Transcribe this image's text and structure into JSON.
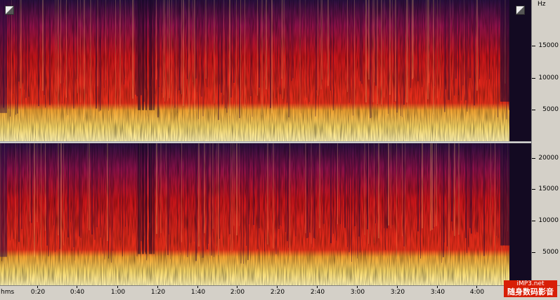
{
  "spectrogram": {
    "freq_unit": "Hz",
    "top_channel_freq_labels": [
      "15000",
      "10000",
      "5000"
    ],
    "bottom_channel_freq_labels": [
      "20000",
      "15000",
      "10000",
      "5000"
    ],
    "time_unit": "hms",
    "time_labels": [
      "0:20",
      "0:40",
      "1:00",
      "1:20",
      "1:40",
      "2:00",
      "2:20",
      "2:40",
      "3:00",
      "3:20",
      "3:40",
      "4:00"
    ],
    "colors": {
      "background": "#000000",
      "low": "#2a1040",
      "mid": "#c8141a",
      "high": "#f4d466",
      "peak": "#fff3b0",
      "ruler": "#d4d0c8"
    }
  },
  "corner_buttons": {
    "left_icon": "zoom-corner-icon",
    "right_icon": "zoom-corner-icon"
  },
  "watermark": {
    "line1": "iMP3.net",
    "line2": "随身数码影音"
  }
}
